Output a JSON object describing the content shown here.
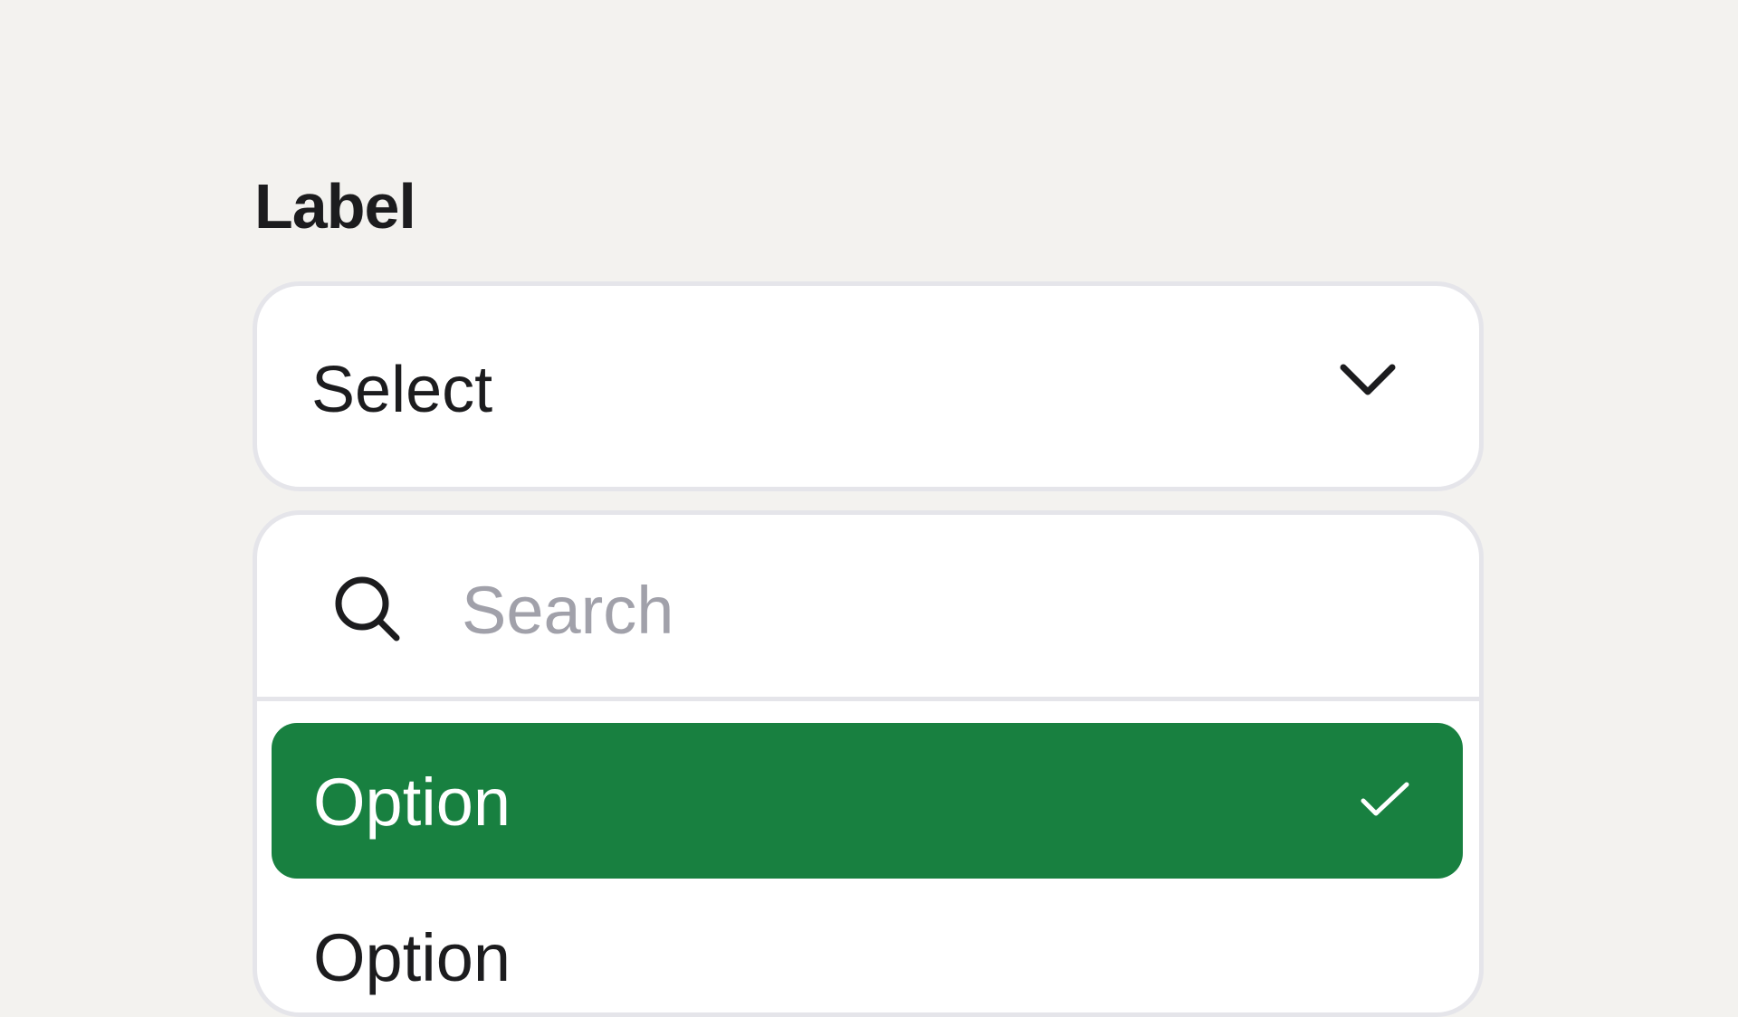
{
  "field": {
    "label": "Label"
  },
  "select": {
    "value": "Select",
    "chevron_icon": "chevron-down-icon"
  },
  "dropdown": {
    "search": {
      "placeholder": "Search",
      "value": "",
      "icon": "search-icon"
    },
    "options": [
      {
        "label": "Option",
        "selected": true,
        "icon": "check-icon"
      },
      {
        "label": "Option",
        "selected": false
      }
    ]
  },
  "colors": {
    "background": "#f3f2ef",
    "surface": "#ffffff",
    "border": "#e5e5ea",
    "text": "#1c1c1e",
    "placeholder": "#a1a1aa",
    "selected_bg": "#188040",
    "selected_text": "#ffffff"
  }
}
